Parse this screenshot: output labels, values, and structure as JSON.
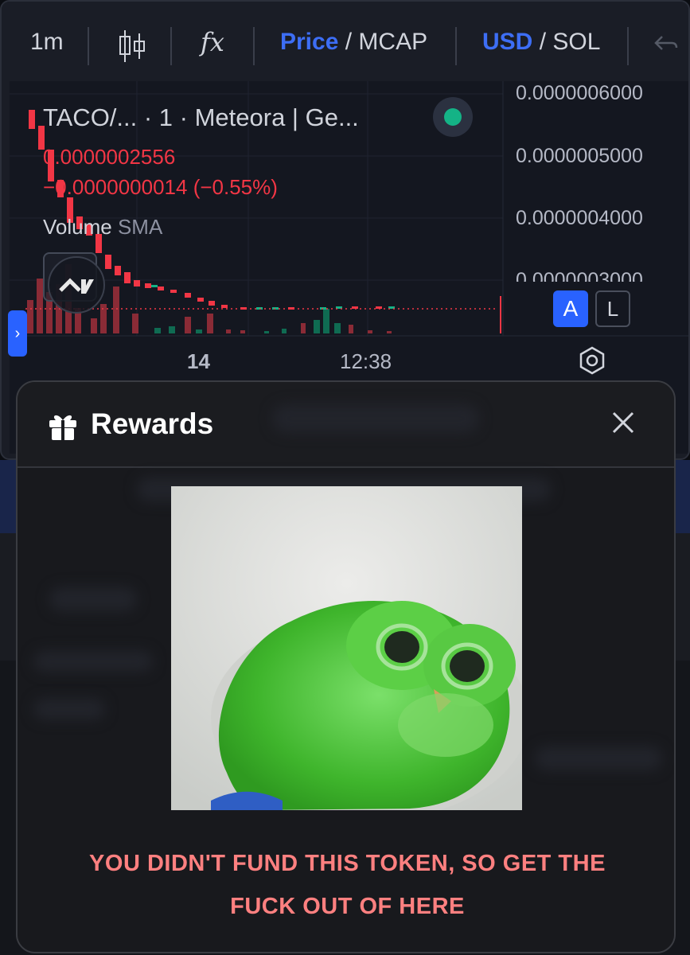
{
  "toolbar": {
    "interval": "1m",
    "fx_label": "fx",
    "price_label": "Price",
    "mcap_label": "MCAP",
    "usd_label": "USD",
    "sol_label": "SOL",
    "slash": "/"
  },
  "chart_header": {
    "pair_title": "TACO/...   · 1 · Meteora | Ge...",
    "price": "0.0000002556",
    "change": "−0.0000000014 (−0.55%)",
    "volume_label": "Volume",
    "sma_label": "SMA",
    "status_color": "#14b386"
  },
  "y_axis": [
    "0.0000006000",
    "0.0000005000",
    "0.0000004000",
    "0.0000003000"
  ],
  "x_axis": {
    "day": "14",
    "time": "12:38"
  },
  "scale_buttons": {
    "auto": "A",
    "log": "L"
  },
  "modal": {
    "title": "Rewards",
    "message_line1": "YOU DIDN'T FUND THIS TOKEN, SO GET THE",
    "message_line2": "FUCK OUT OF HERE",
    "message_color": "#ff8080"
  },
  "colors": {
    "accent": "#2962ff",
    "down": "#f23645",
    "up": "#14b386"
  }
}
